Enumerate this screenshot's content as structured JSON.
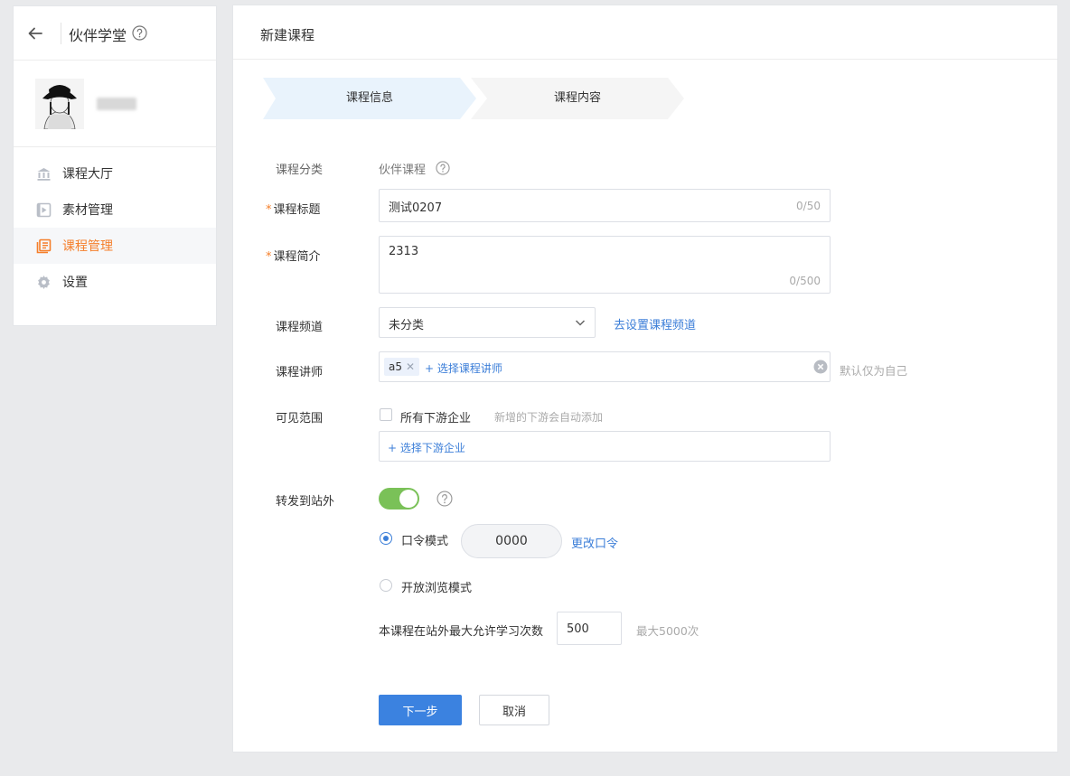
{
  "sidebar": {
    "title": "伙伴学堂",
    "nav": [
      {
        "label": "课程大厅",
        "icon": "bank-icon"
      },
      {
        "label": "素材管理",
        "icon": "media-icon"
      },
      {
        "label": "课程管理",
        "icon": "course-list-icon",
        "active": true
      },
      {
        "label": "设置",
        "icon": "gear-icon"
      }
    ]
  },
  "page": {
    "title": "新建课程",
    "steps": [
      "课程信息",
      "课程内容"
    ]
  },
  "form": {
    "category": {
      "label": "课程分类",
      "value": "伙伴课程"
    },
    "title": {
      "label": "课程标题",
      "value": "测试0207",
      "counter": "0/50"
    },
    "intro": {
      "label": "课程简介",
      "value": "2313",
      "counter": "0/500"
    },
    "channel": {
      "label": "课程频道",
      "value": "未分类",
      "link": "去设置课程频道"
    },
    "teacher": {
      "label": "课程讲师",
      "tag": "a5",
      "add_link": "+ 选择课程讲师",
      "hint": "默认仅为自己"
    },
    "scope": {
      "label": "可见范围",
      "checkbox_label": "所有下游企业",
      "hint": "新增的下游会自动添加",
      "add_link": "+ 选择下游企业"
    },
    "share": {
      "label": "转发到站外",
      "toggle_on": true,
      "password_mode_label": "口令模式",
      "password_value": "0000",
      "change_password_link": "更改口令",
      "open_mode_label": "开放浏览模式",
      "max_label": "本课程在站外最大允许学习次数",
      "max_value": "500",
      "max_hint": "最大5000次"
    }
  },
  "buttons": {
    "next": "下一步",
    "cancel": "取消"
  },
  "colors": {
    "accent": "#f57f2a",
    "primary": "#3b82e0",
    "toggle": "#7ac158"
  }
}
